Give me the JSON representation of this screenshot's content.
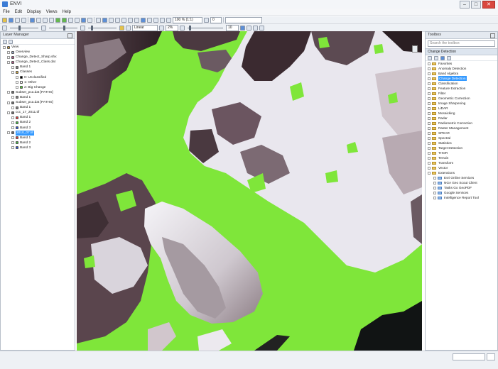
{
  "window": {
    "title": "ENVI",
    "controls": [
      "–",
      "□",
      "✕"
    ]
  },
  "menu": [
    "File",
    "Edit",
    "Display",
    "Views",
    "Help"
  ],
  "toolbar": {
    "zoom_combo": "100 % (1:1)",
    "stretch_combo": "Linear",
    "percent_combo": "2%",
    "rotation_combo": "0",
    "opacity": "10"
  },
  "layer_manager": {
    "title": "Layer Manager",
    "rows": [
      {
        "label": "View",
        "indent": 0,
        "icon": "#d2a640"
      },
      {
        "label": "Overview",
        "indent": 1,
        "icon": "#9aa9c8"
      },
      {
        "label": "Change_Detect_Sharp.shx",
        "indent": 1,
        "icon": "#b45a8a"
      },
      {
        "label": "Change_Detect_Class.dat",
        "indent": 1,
        "icon": "#b45a8a"
      },
      {
        "label": "Band 1",
        "indent": 2,
        "icon": "#7f7f7f"
      },
      {
        "label": "Classes",
        "indent": 2,
        "icon": "#d2a640"
      },
      {
        "label": "0: Unclassified",
        "indent": 3,
        "icon": "#000000"
      },
      {
        "label": "1: Other",
        "indent": 3,
        "icon": "#ffffff"
      },
      {
        "label": "2: Big Change",
        "indent": 3,
        "icon": "#55d230"
      },
      {
        "label": "Subset_pca.dat [PATHS]",
        "indent": 1,
        "icon": "#6b6b6b"
      },
      {
        "label": "Band 1",
        "indent": 2,
        "icon": "#7f7f7f"
      },
      {
        "label": "Subset_pca.dat [PATHS]",
        "indent": 1,
        "icon": "#6b6b6b"
      },
      {
        "label": "Band 1",
        "indent": 2,
        "icon": "#7f7f7f"
      },
      {
        "label": "ccc_17_2011.tif",
        "indent": 1,
        "icon": "#6b6b6b"
      },
      {
        "label": "Band 1",
        "indent": 2,
        "icon": "#e23b3b"
      },
      {
        "label": "Band 2",
        "indent": 2,
        "icon": "#44b944"
      },
      {
        "label": "Band 3",
        "indent": 2,
        "icon": "#2f55d6"
      },
      {
        "label": "2010_07.tif",
        "indent": 1,
        "icon": "#6b6b6b",
        "selected": true
      },
      {
        "label": "Band 1",
        "indent": 2,
        "icon": "#e23b3b"
      },
      {
        "label": "Band 2",
        "indent": 2,
        "icon": "#44b944"
      },
      {
        "label": "Band 3",
        "indent": 2,
        "icon": "#2f55d6"
      }
    ]
  },
  "toolbox": {
    "title": "Toolbox",
    "search_placeholder": "Search the toolbox",
    "section": "Change Detection",
    "items": [
      {
        "label": "Favorites"
      },
      {
        "label": "Anomaly Detection"
      },
      {
        "label": "Band Algebra"
      },
      {
        "label": "Change Detection",
        "selected": true
      },
      {
        "label": "Classification"
      },
      {
        "label": "Feature Extraction"
      },
      {
        "label": "Filter"
      },
      {
        "label": "Geometric Correction"
      },
      {
        "label": "Image Sharpening"
      },
      {
        "label": "LiDAR"
      },
      {
        "label": "Mosaicking"
      },
      {
        "label": "Radar"
      },
      {
        "label": "Radiometric Correction"
      },
      {
        "label": "Raster Management"
      },
      {
        "label": "SPEAR"
      },
      {
        "label": "Spectral"
      },
      {
        "label": "Statistics"
      },
      {
        "label": "Target Detection"
      },
      {
        "label": "THOR"
      },
      {
        "label": "Terrain"
      },
      {
        "label": "Transform"
      },
      {
        "label": "Vector"
      },
      {
        "label": "Extensions"
      },
      {
        "label": "Esri Online Services",
        "sub": true
      },
      {
        "label": "NGA Geo Scout Client",
        "sub": true
      },
      {
        "label": "Tasks Go GeoPDF",
        "sub": true
      },
      {
        "label": "Google Services",
        "sub": true
      },
      {
        "label": "Intelligence Report Tool",
        "sub": true
      }
    ]
  },
  "colors": {
    "change_green": "#7fe63a",
    "snow": "#f1f0f4",
    "rock_dark": "#3b2a30",
    "water_dark": "#111414"
  }
}
